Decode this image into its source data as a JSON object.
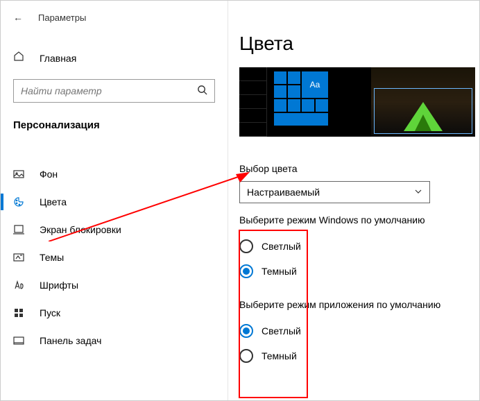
{
  "header": {
    "back_icon": "←",
    "title": "Параметры"
  },
  "home": {
    "label": "Главная"
  },
  "search": {
    "placeholder": "Найти параметр"
  },
  "section": {
    "title": "Персонализация"
  },
  "nav": {
    "items": [
      {
        "label": "Фон"
      },
      {
        "label": "Цвета"
      },
      {
        "label": "Экран блокировки"
      },
      {
        "label": "Темы"
      },
      {
        "label": "Шрифты"
      },
      {
        "label": "Пуск"
      },
      {
        "label": "Панель задач"
      }
    ]
  },
  "main": {
    "title": "Цвета",
    "tile_aa": "Aa",
    "color_choice": {
      "label": "Выбор цвета",
      "value": "Настраиваемый"
    },
    "windows_mode": {
      "label": "Выберите режим Windows по умолчанию",
      "options": [
        {
          "label": "Светлый",
          "selected": false
        },
        {
          "label": "Темный",
          "selected": true
        }
      ]
    },
    "app_mode": {
      "label": "Выберите режим приложения по умолчанию",
      "options": [
        {
          "label": "Светлый",
          "selected": true
        },
        {
          "label": "Темный",
          "selected": false
        }
      ]
    }
  }
}
